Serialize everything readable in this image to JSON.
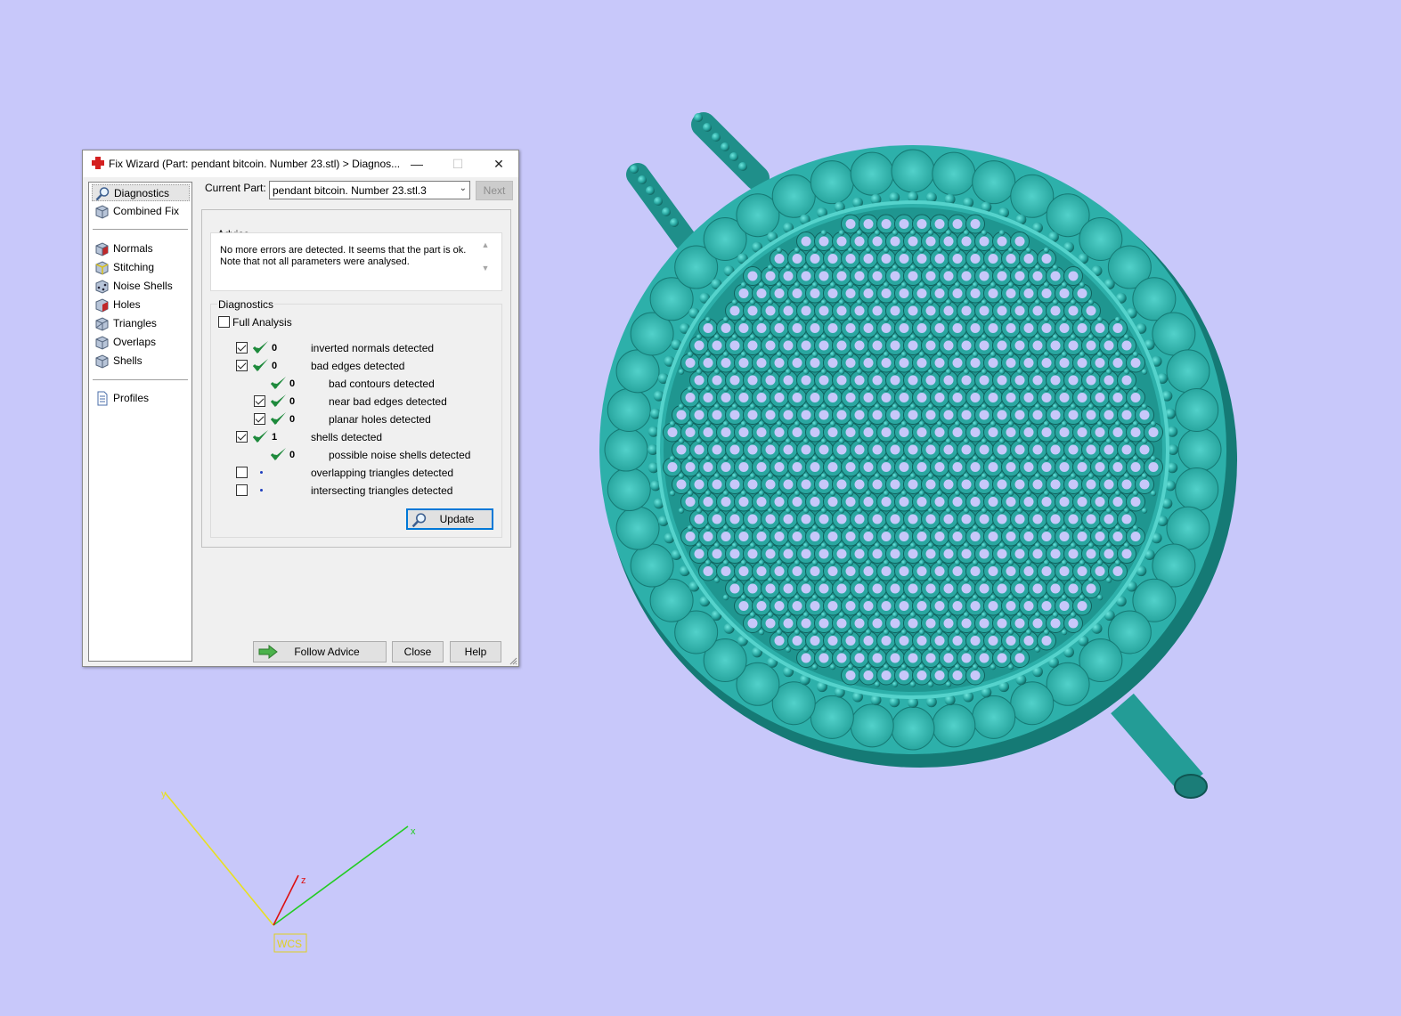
{
  "dialog": {
    "title": "Fix Wizard (Part: pendant bitcoin. Number 23.stl) > Diagnos...",
    "window_buttons": {
      "minimize": "—",
      "maximize": "☐",
      "close": "✕"
    },
    "nav": {
      "items_top": [
        {
          "label": "Diagnostics",
          "icon": "magnifier-icon",
          "selected": true
        },
        {
          "label": "Combined Fix",
          "icon": "cube-icon",
          "selected": false
        }
      ],
      "items_mid": [
        {
          "label": "Normals",
          "icon": "normals-cube-icon"
        },
        {
          "label": "Stitching",
          "icon": "stitching-cube-icon"
        },
        {
          "label": "Noise Shells",
          "icon": "noise-shells-cube-icon"
        },
        {
          "label": "Holes",
          "icon": "holes-cube-icon"
        },
        {
          "label": "Triangles",
          "icon": "triangles-cube-icon"
        },
        {
          "label": "Overlaps",
          "icon": "overlaps-cube-icon"
        },
        {
          "label": "Shells",
          "icon": "shells-cube-icon"
        }
      ],
      "items_bottom": [
        {
          "label": "Profiles",
          "icon": "document-icon"
        }
      ]
    },
    "current_part_label": "Current Part:",
    "current_part_value": "pendant bitcoin. Number 23.stl.3",
    "next_label": "Next",
    "advice": {
      "heading": "Advice",
      "text": "No more errors are detected. It seems that the part is ok. Note that not all parameters were analysed."
    },
    "diagnostics": {
      "heading": "Diagnostics",
      "full_analysis_label": "Full Analysis",
      "full_analysis_checked": false,
      "rows": [
        {
          "checkbox": true,
          "checked": true,
          "status": "ok",
          "count": "0",
          "text": "inverted normals detected",
          "indent": 0
        },
        {
          "checkbox": true,
          "checked": true,
          "status": "ok",
          "count": "0",
          "text": "bad edges detected",
          "indent": 0
        },
        {
          "checkbox": false,
          "checked": false,
          "status": "ok",
          "count": "0",
          "text": "bad contours detected",
          "indent": 1
        },
        {
          "checkbox": true,
          "checked": true,
          "status": "ok",
          "count": "0",
          "text": "near bad edges detected",
          "indent": 1
        },
        {
          "checkbox": true,
          "checked": true,
          "status": "ok",
          "count": "0",
          "text": "planar holes detected",
          "indent": 1
        },
        {
          "checkbox": true,
          "checked": true,
          "status": "ok",
          "count": "1",
          "text": "shells detected",
          "indent": 0
        },
        {
          "checkbox": false,
          "checked": false,
          "status": "ok",
          "count": "0",
          "text": "possible noise shells detected",
          "indent": 1
        },
        {
          "checkbox": true,
          "checked": false,
          "status": "unknown",
          "count": "",
          "text": "overlapping triangles detected",
          "indent": 0
        },
        {
          "checkbox": true,
          "checked": false,
          "status": "unknown",
          "count": "",
          "text": "intersecting triangles detected",
          "indent": 0
        }
      ],
      "update_label": "Update"
    },
    "buttons": {
      "follow_advice": "Follow Advice",
      "close": "Close",
      "help": "Help"
    }
  },
  "axes": {
    "x_label": "x",
    "y_label": "y",
    "z_label": "z",
    "wcs_label": "WCS"
  },
  "colors": {
    "background": "#c8c8fa",
    "model": "#2fb3ad",
    "check_green": "#1e8a3c",
    "x_axis": "#22cc22",
    "y_axis": "#e8e020",
    "z_axis": "#dd1111"
  }
}
